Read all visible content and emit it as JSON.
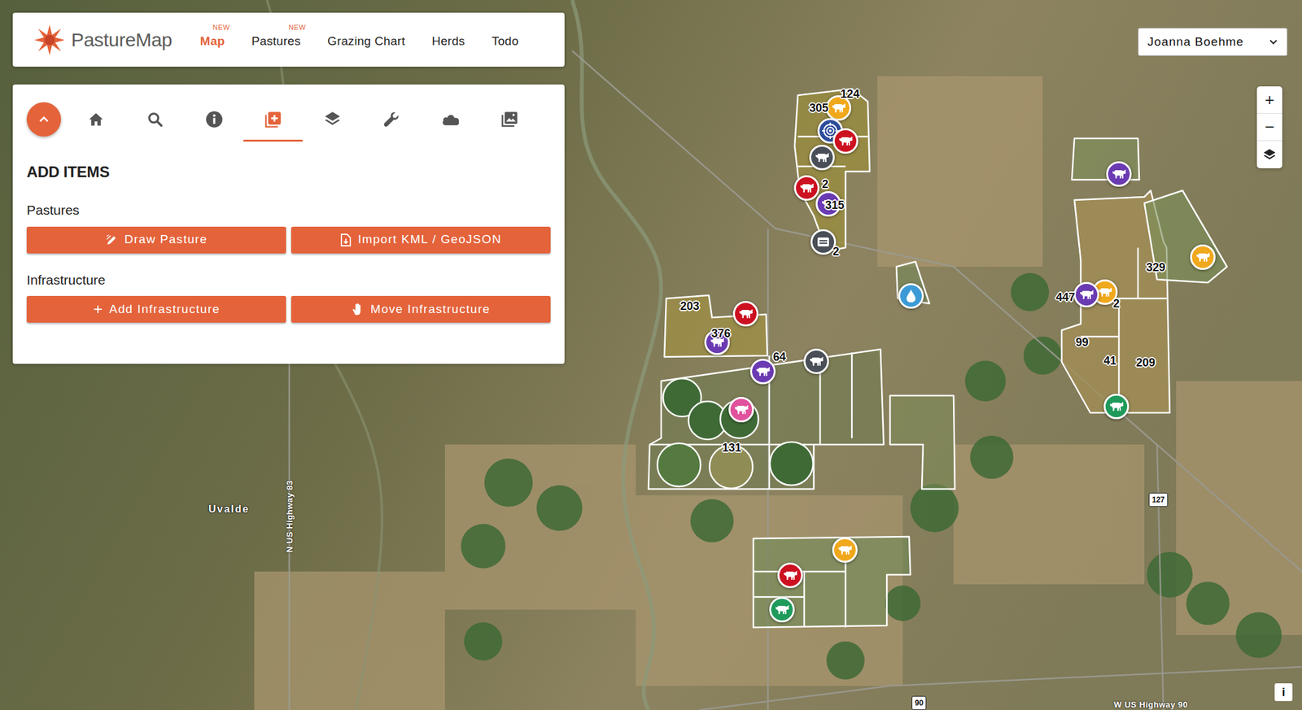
{
  "app": {
    "logo": "PastureMap",
    "user": "Joanna Boehme"
  },
  "nav": [
    {
      "label": "Map",
      "badge": "NEW",
      "selected": true
    },
    {
      "label": "Pastures",
      "badge": "NEW",
      "selected": false
    },
    {
      "label": "Grazing Chart",
      "selected": false
    },
    {
      "label": "Herds",
      "selected": false
    },
    {
      "label": "Todo",
      "selected": false
    }
  ],
  "toolbar": [
    {
      "selected": false
    },
    {
      "selected": false
    },
    {
      "selected": false
    },
    {
      "selected": true
    },
    {
      "selected": false
    },
    {
      "selected": false
    },
    {
      "selected": false
    },
    {
      "selected": false
    }
  ],
  "panel": {
    "title": "ADD ITEMS",
    "sections": [
      {
        "label": "Pastures",
        "buttons": [
          "Draw Pasture",
          "Import KML / GeoJSON"
        ]
      },
      {
        "label": "Infrastructure",
        "buttons": [
          "Add Infrastructure",
          "Move Infrastructure"
        ]
      }
    ]
  },
  "zoom": [
    "+",
    "−"
  ],
  "map": {
    "places": [
      {
        "text": "Uvalde",
        "kind": "town"
      },
      {
        "text": "N US Highway 83",
        "kind": "road"
      },
      {
        "text": "127",
        "kind": "shield"
      },
      {
        "text": "90",
        "kind": "shield"
      },
      {
        "text": "W US Highway 90",
        "kind": "roadh"
      }
    ],
    "markers": [
      {
        "kind": "herd",
        "color": "#f0a81c"
      },
      {
        "kind": "target",
        "color": "#2b4c9b"
      },
      {
        "kind": "herd",
        "color": "#cc1020"
      },
      {
        "kind": "herd",
        "color": "#4a4f57"
      },
      {
        "kind": "herd",
        "color": "#cc1020"
      },
      {
        "kind": "herd",
        "color": "#6a3ab2"
      },
      {
        "kind": "equipment",
        "color": "#4a4f57"
      },
      {
        "kind": "herd",
        "color": "#6a3ab2"
      },
      {
        "kind": "herd",
        "color": "#f0a81c"
      },
      {
        "kind": "herd",
        "color": "#f0a81c"
      },
      {
        "kind": "herd",
        "color": "#6a3ab2"
      },
      {
        "kind": "herd",
        "color": "#1f9a5a"
      },
      {
        "kind": "water",
        "color": "#3c9bd6"
      },
      {
        "kind": "herd",
        "color": "#cc1020"
      },
      {
        "kind": "herd",
        "color": "#6a3ab2"
      },
      {
        "kind": "herd",
        "color": "#6a3ab2"
      },
      {
        "kind": "herd",
        "color": "#4a4f57"
      },
      {
        "kind": "herd",
        "color": "#e0529c"
      },
      {
        "kind": "herd",
        "color": "#f0a81c"
      },
      {
        "kind": "herd",
        "color": "#cc1020"
      },
      {
        "kind": "herd",
        "color": "#1f9a5a"
      }
    ],
    "labels": [
      "124",
      "305",
      "2",
      "315",
      "2",
      "203",
      "376",
      "64",
      "131",
      "329",
      "447",
      "2",
      "99",
      "41",
      "209"
    ],
    "info": "i"
  }
}
